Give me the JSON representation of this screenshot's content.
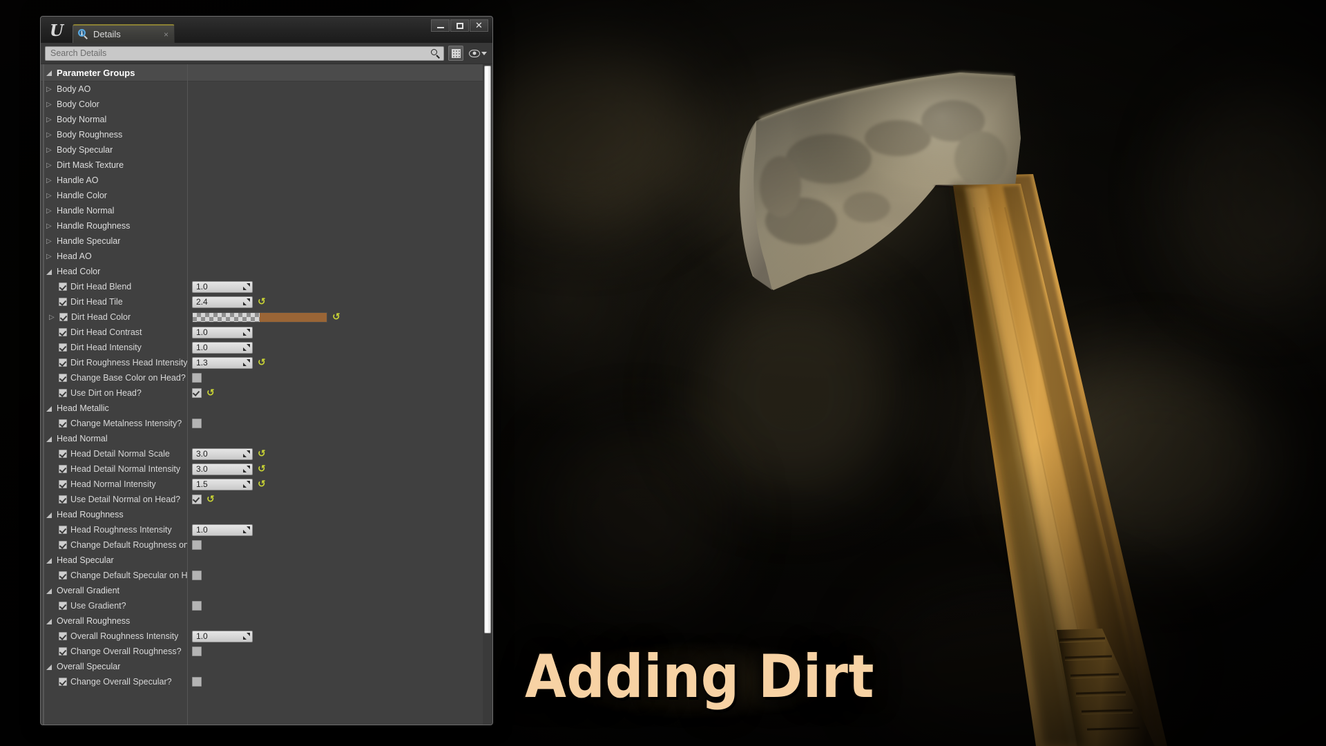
{
  "window": {
    "logo_glyph": "U",
    "tab_label": "Details",
    "tab_close_glyph": "×",
    "minimize_label": "Minimize",
    "maximize_label": "Maximize",
    "close_glyph": "✕"
  },
  "toolbar": {
    "search_placeholder": "Search Details",
    "search_value": "",
    "grid_button_label": "Column Settings",
    "eye_button_label": "View Options"
  },
  "panel": {
    "header": "Parameter Groups"
  },
  "colors": {
    "tab_accent": "#8a8034",
    "reset_arrow": "#cbd634",
    "dirt_head_color_swatch": "#9a6536",
    "title_fill": "#f7d2a4",
    "title_outline": "#120d07"
  },
  "title_overlay": {
    "text": "Adding Dirt"
  },
  "rows": [
    {
      "kind": "header",
      "label": "Parameter Groups"
    },
    {
      "kind": "group_collapsed",
      "label": "Body AO"
    },
    {
      "kind": "group_collapsed",
      "label": "Body Color"
    },
    {
      "kind": "group_collapsed",
      "label": "Body Normal"
    },
    {
      "kind": "group_collapsed",
      "label": "Body Roughness"
    },
    {
      "kind": "group_collapsed",
      "label": "Body Specular"
    },
    {
      "kind": "group_collapsed",
      "label": "Dirt Mask Texture"
    },
    {
      "kind": "group_collapsed",
      "label": "Handle AO"
    },
    {
      "kind": "group_collapsed",
      "label": "Handle Color"
    },
    {
      "kind": "group_collapsed",
      "label": "Handle Normal"
    },
    {
      "kind": "group_collapsed",
      "label": "Handle Roughness"
    },
    {
      "kind": "group_collapsed",
      "label": "Handle Specular"
    },
    {
      "kind": "group_collapsed",
      "label": "Head AO"
    },
    {
      "kind": "group_expanded",
      "label": "Head Color"
    },
    {
      "kind": "param_number",
      "label": "Dirt Head Blend",
      "checked": true,
      "value": "1.0",
      "reset": false
    },
    {
      "kind": "param_number",
      "label": "Dirt Head Tile",
      "checked": true,
      "value": "2.4",
      "reset": true
    },
    {
      "kind": "param_color",
      "label": "Dirt Head Color",
      "checked": true,
      "expandable": true,
      "reset": true
    },
    {
      "kind": "param_number",
      "label": "Dirt Head Contrast",
      "checked": true,
      "value": "1.0",
      "reset": false
    },
    {
      "kind": "param_number",
      "label": "Dirt Head Intensity",
      "checked": true,
      "value": "1.0",
      "reset": false
    },
    {
      "kind": "param_number",
      "label": "Dirt Roughness Head Intensity",
      "checked": true,
      "value": "1.3",
      "reset": true
    },
    {
      "kind": "param_bool",
      "label": "Change Base Color on Head?",
      "checked": true,
      "value_checked": false,
      "reset": false
    },
    {
      "kind": "param_bool",
      "label": "Use Dirt on Head?",
      "checked": true,
      "value_checked": true,
      "reset": true
    },
    {
      "kind": "group_expanded",
      "label": "Head Metallic"
    },
    {
      "kind": "param_bool",
      "label": "Change Metalness Intensity?",
      "checked": true,
      "value_checked": false,
      "reset": false
    },
    {
      "kind": "group_expanded",
      "label": "Head Normal"
    },
    {
      "kind": "param_number",
      "label": "Head Detail Normal Scale",
      "checked": true,
      "value": "3.0",
      "reset": true
    },
    {
      "kind": "param_number",
      "label": "Head Detail Normal Intensity",
      "checked": true,
      "value": "3.0",
      "reset": true
    },
    {
      "kind": "param_number",
      "label": "Head Normal Intensity",
      "checked": true,
      "value": "1.5",
      "reset": true
    },
    {
      "kind": "param_bool",
      "label": "Use Detail Normal on Head?",
      "checked": true,
      "value_checked": true,
      "reset": true
    },
    {
      "kind": "group_expanded",
      "label": "Head Roughness"
    },
    {
      "kind": "param_number",
      "label": "Head Roughness Intensity",
      "checked": true,
      "value": "1.0",
      "reset": false
    },
    {
      "kind": "param_bool",
      "label": "Change Default Roughness on Head?",
      "checked": true,
      "value_checked": false,
      "reset": false
    },
    {
      "kind": "group_expanded",
      "label": "Head Specular"
    },
    {
      "kind": "param_bool",
      "label": "Change Default Specular on Head?",
      "checked": true,
      "value_checked": false,
      "reset": false
    },
    {
      "kind": "group_expanded",
      "label": "Overall Gradient"
    },
    {
      "kind": "param_bool",
      "label": "Use Gradient?",
      "checked": true,
      "value_checked": false,
      "reset": false
    },
    {
      "kind": "group_expanded",
      "label": "Overall Roughness"
    },
    {
      "kind": "param_number",
      "label": "Overall Roughness Intensity",
      "checked": true,
      "value": "1.0",
      "reset": false
    },
    {
      "kind": "param_bool",
      "label": "Change Overall Roughness?",
      "checked": true,
      "value_checked": false,
      "reset": false
    },
    {
      "kind": "group_expanded",
      "label": "Overall Specular"
    },
    {
      "kind": "param_bool",
      "label": "Change Overall Specular?",
      "checked": true,
      "value_checked": false,
      "reset": false
    }
  ]
}
